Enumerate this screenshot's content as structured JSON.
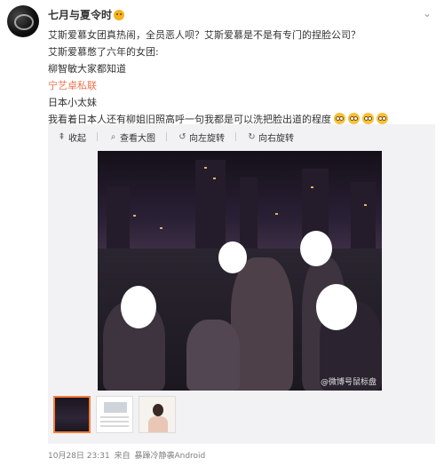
{
  "post": {
    "username": "七月与夏令时",
    "username_emoji_icon": "smiley-face-icon",
    "menu_icon": "chevron-down-icon",
    "lines": [
      "艾斯爱慕女团真热闹，全员恶人呗？艾斯爱慕是不是有专门的捏脸公司？",
      "艾斯爱慕憋了六年的女团:",
      "柳智敏大家都知道",
      "宁艺卓私联",
      "日本小太妹",
      "我看着日本人还有柳姐旧照高呼一句我都是可以洗把脸出道的程度"
    ],
    "link_line_index": 3,
    "link_color": "#eb7350",
    "trailing_emoji_count": 4,
    "trailing_emoji_icon": "shy-face-icon"
  },
  "media_toolbar": {
    "collapse": "收起",
    "view_large": "查看大图",
    "rotate_left": "向左旋转",
    "rotate_right": "向右旋转"
  },
  "photo": {
    "watermark": "@微博号鼠标盘"
  },
  "thumbnails": [
    {
      "name": "thumbnail-night-rooftop",
      "active": true
    },
    {
      "name": "thumbnail-document"
    },
    {
      "name": "thumbnail-portrait"
    }
  ],
  "footer": {
    "timestamp": "10月28日 23:31",
    "source_prefix": "来自",
    "source": "暴躁冷静袭Android"
  },
  "colors": {
    "accent": "#fa7d3c",
    "text": "#333333",
    "muted": "#808080",
    "panel": "#f2f2f5"
  }
}
